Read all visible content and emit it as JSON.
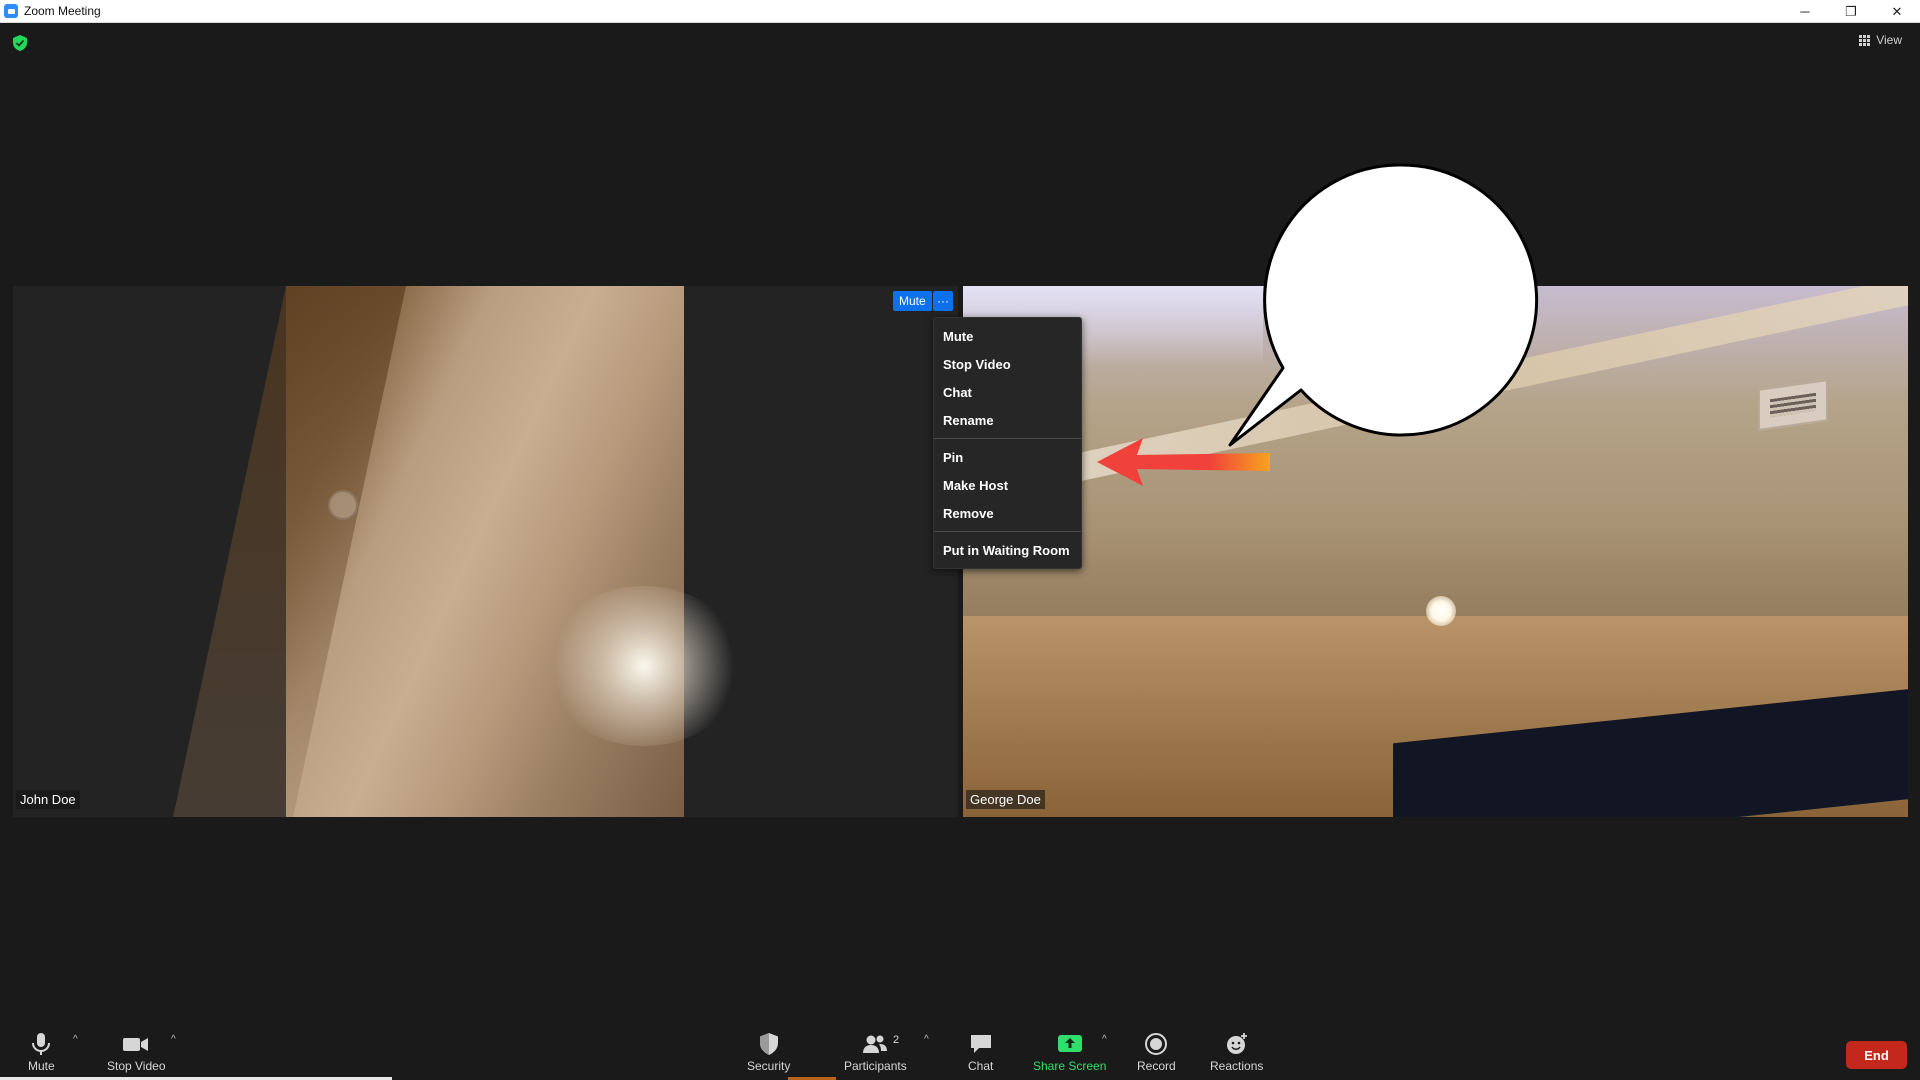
{
  "window": {
    "title": "Zoom Meeting",
    "minimize": "─",
    "restore": "❐",
    "close": "✕"
  },
  "top": {
    "view_label": "View"
  },
  "participants": [
    {
      "name": "John Doe"
    },
    {
      "name": "George Doe"
    }
  ],
  "tile_controls": {
    "mute_label": "Mute",
    "more_label": "···"
  },
  "context_menu": {
    "items_a": [
      "Mute",
      "Stop Video",
      "Chat",
      "Rename"
    ],
    "items_b": [
      "Pin",
      "Make Host",
      "Remove"
    ],
    "items_c": [
      "Put in Waiting Room"
    ]
  },
  "toolbar": {
    "mute": "Mute",
    "stop_video": "Stop Video",
    "security": "Security",
    "participants": "Participants",
    "participants_count": "2",
    "chat": "Chat",
    "share_screen": "Share Screen",
    "record": "Record",
    "reactions": "Reactions",
    "end": "End",
    "caret": "^"
  },
  "icons": {
    "shield": "encryption-shield-icon",
    "view": "grid-view-icon",
    "mic": "microphone-icon",
    "camera": "camera-icon",
    "security": "security-shield-icon",
    "participants": "participants-icon",
    "chat": "chat-bubble-icon",
    "share": "share-screen-icon",
    "record": "record-icon",
    "reactions": "reactions-icon"
  },
  "colors": {
    "accent_blue": "#0e71eb",
    "share_green": "#2ee06b",
    "end_red": "#c4281c",
    "annotation_arrow": "#f0423a"
  }
}
